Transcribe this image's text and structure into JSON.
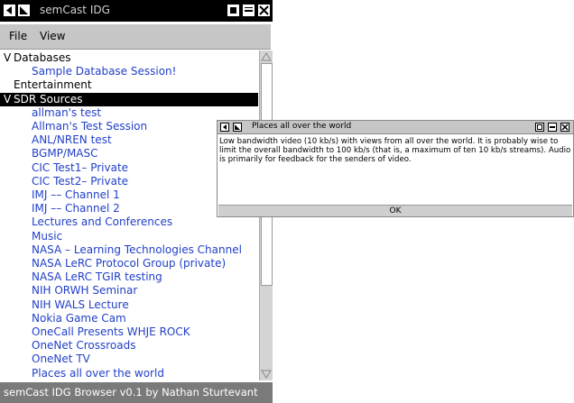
{
  "main_window": {
    "title": "semCast IDG",
    "menu": [
      "File",
      "View"
    ],
    "tree": [
      {
        "type": "group",
        "marker": "V",
        "label": "Databases"
      },
      {
        "type": "item",
        "label": "Sample Database Session!"
      },
      {
        "type": "group",
        "marker": "",
        "label": "Entertainment"
      },
      {
        "type": "group",
        "marker": "V",
        "label": "SDR Sources",
        "selected": true
      },
      {
        "type": "item",
        "label": "allman's test"
      },
      {
        "type": "item",
        "label": "Allman's Test Session"
      },
      {
        "type": "item",
        "label": "ANL/NREN test"
      },
      {
        "type": "item",
        "label": "BGMP/MASC"
      },
      {
        "type": "item",
        "label": "CIC Test1– Private"
      },
      {
        "type": "item",
        "label": "CIC Test2– Private"
      },
      {
        "type": "item",
        "label": "IMJ –– Channel 1"
      },
      {
        "type": "item",
        "label": "IMJ –– Channel 2"
      },
      {
        "type": "item",
        "label": "Lectures and Conferences"
      },
      {
        "type": "item",
        "label": "Music"
      },
      {
        "type": "item",
        "label": "NASA – Learning Technologies Channel"
      },
      {
        "type": "item",
        "label": "NASA LeRC Protocol Group (private)"
      },
      {
        "type": "item",
        "label": "NASA LeRC TGIR testing"
      },
      {
        "type": "item",
        "label": "NIH ORWH Seminar"
      },
      {
        "type": "item",
        "label": "NIH WALS Lecture"
      },
      {
        "type": "item",
        "label": "Nokia  Game Cam"
      },
      {
        "type": "item",
        "label": "OneCall Presents WHJE ROCK"
      },
      {
        "type": "item",
        "label": "OneNet Crossroads"
      },
      {
        "type": "item",
        "label": "OneNet TV"
      },
      {
        "type": "item",
        "label": "Places all over the world"
      }
    ],
    "status": "semCast IDG Browser v0.1 by Nathan Sturtevant"
  },
  "dialog": {
    "title": "Places all over the world",
    "body": "Low bandwidth video (10 kb/s) with views from all over the world. It is probably wise to limit the overall bandwidth to 100 kb/s (that is, a maximum of ten 10 kb/s streams).  Audio is primarily for feedback for the senders of video.",
    "ok_label": "OK"
  },
  "icons": {
    "window_menu": "window-menu-icon",
    "sticky": "sticky-icon",
    "iconify": "iconify-icon",
    "maximize": "maximize-icon",
    "close": "close-icon"
  },
  "colors": {
    "link": "#2240c8",
    "selection": "#000000",
    "menubar": "#c6c6c6",
    "statusbar": "#7a7a7a"
  }
}
